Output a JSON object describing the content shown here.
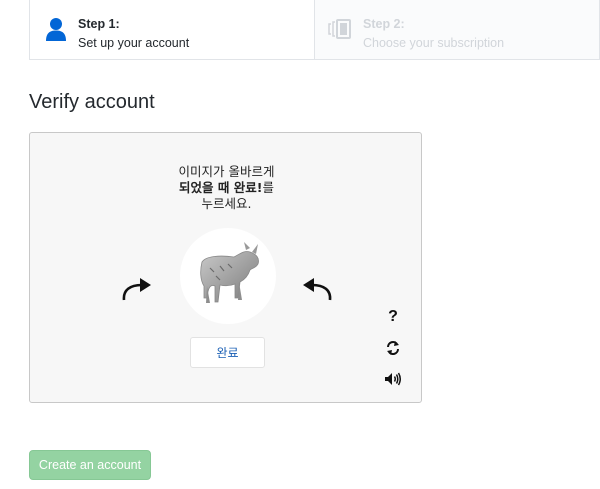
{
  "steps": [
    {
      "title": "Step 1:",
      "subtitle": "Set up your account",
      "state": "active",
      "icon": "person-icon"
    },
    {
      "title": "Step 2:",
      "subtitle": "Choose your subscription",
      "state": "inactive",
      "icon": "subscription-icon"
    }
  ],
  "heading": "Verify account",
  "captcha": {
    "instruction_line1": "이미지가 올바르게",
    "instruction_line2_bold": "되었을 때 완료!",
    "instruction_line2_rest": "를",
    "instruction_line3": "누르세요.",
    "image_icon": "goat-image",
    "rotate_left_icon": "rotate-left-arrow-icon",
    "rotate_right_icon": "rotate-right-arrow-icon",
    "done_label": "완료",
    "help_label": "?",
    "refresh_icon": "refresh-icon",
    "audio_icon": "speaker-icon"
  },
  "create_button_label": "Create an account",
  "colors": {
    "accent_blue": "#0366d6",
    "create_button_bg": "#94d3a2",
    "done_text": "#1a5fb4"
  }
}
